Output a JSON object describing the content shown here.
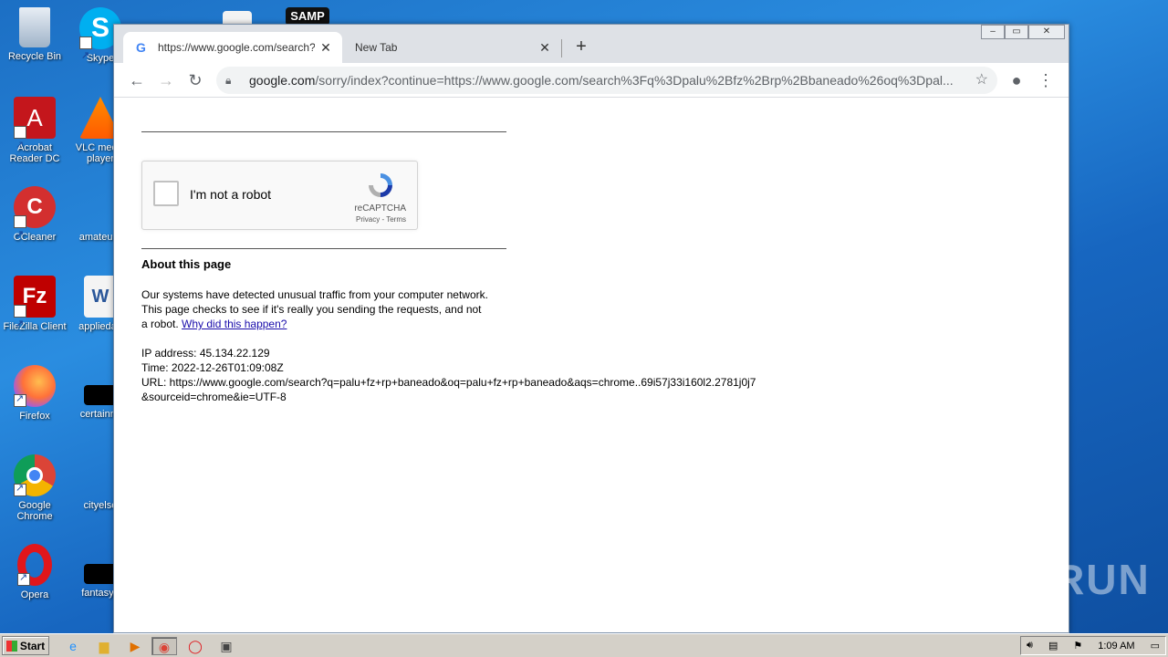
{
  "desktop": {
    "icons": [
      {
        "label": "Recycle Bin"
      },
      {
        "label": "Skype"
      },
      {
        "label": "Acrobat Reader DC"
      },
      {
        "label": "VLC media player"
      },
      {
        "label": "CCleaner"
      },
      {
        "label": "amateurn"
      },
      {
        "label": "FileZilla Client"
      },
      {
        "label": "appliedag"
      },
      {
        "label": "Firefox"
      },
      {
        "label": "certainmi"
      },
      {
        "label": "Google Chrome"
      },
      {
        "label": "cityelse"
      },
      {
        "label": "Opera"
      },
      {
        "label": "fantasyu"
      }
    ],
    "top_icon_label": "SAMP"
  },
  "browser": {
    "tabs": [
      {
        "title": "https://www.google.com/search?q=",
        "favicon": "G"
      },
      {
        "title": "New Tab"
      }
    ],
    "newtab_label": "+",
    "address": {
      "host": "google.com",
      "path": "/sorry/index?continue=https://www.google.com/search%3Fq%3Dpalu%2Bfz%2Brp%2Bbaneado%26oq%3Dpal..."
    }
  },
  "page": {
    "captcha": {
      "label": "I'm not a robot",
      "brand": "reCAPTCHA",
      "terms": "Privacy - Terms"
    },
    "about_title": "About this page",
    "paragraph": "Our systems have detected unusual traffic from your computer network. This page checks to see if it's really you sending the requests, and not a robot.",
    "why_link": "Why did this happen?",
    "ip_line": "IP address: 45.134.22.129",
    "time_line": "Time: 2022-12-26T01:09:08Z",
    "url_line": "URL: https://www.google.com/search?q=palu+fz+rp+baneado&oq=palu+fz+rp+baneado&aqs=chrome..69i57j33i160l2.2781j0j7&sourceid=chrome&ie=UTF-8"
  },
  "watermark": "ANY RUN",
  "taskbar": {
    "start_label": "Start",
    "clock": "1:09 AM"
  }
}
